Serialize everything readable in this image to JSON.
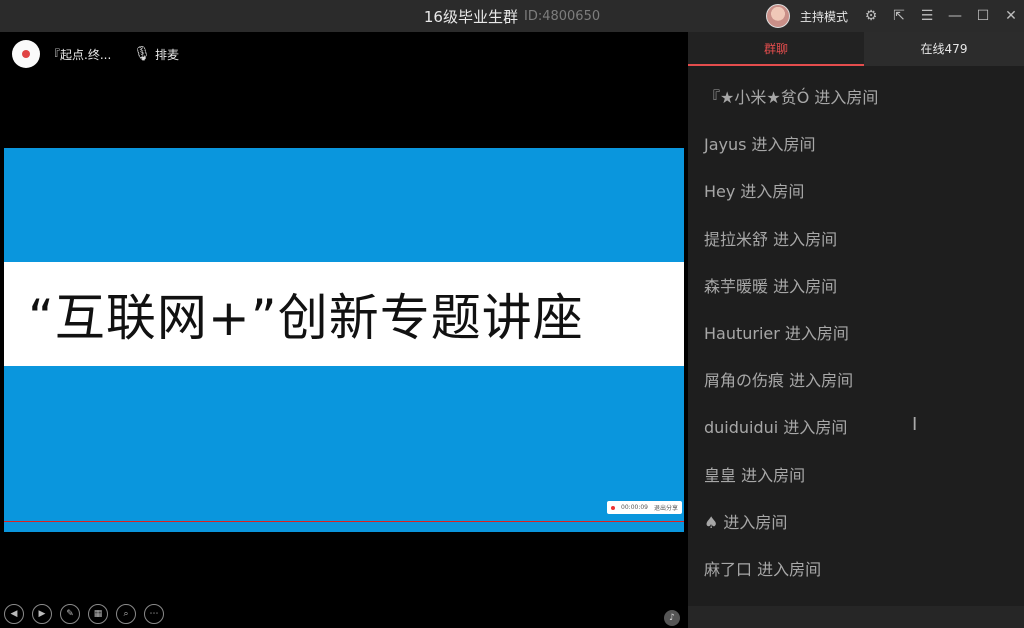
{
  "titlebar": {
    "title": "16级毕业生群",
    "room_id": "ID:4800650",
    "host_mode_label": "主持模式",
    "icons": [
      "host-avatar",
      "gear-icon",
      "popout-icon",
      "menu-icon",
      "minimize-icon",
      "maximize-icon",
      "close-icon"
    ]
  },
  "stage": {
    "presenter_name": "『起点.终...",
    "queue_label": "排麦",
    "slide": {
      "title": "“互联网+”创新专题讲座",
      "colors": {
        "background": "#0a96dd",
        "band": "#ffffff"
      },
      "recording": {
        "time": "00:00:09",
        "exit_label": "退出分享"
      }
    },
    "controls": [
      "prev-icon",
      "next-icon",
      "pen-icon",
      "layout-icon",
      "zoom-icon",
      "more-icon"
    ]
  },
  "panel": {
    "tabs": [
      {
        "label": "群聊",
        "active": true
      },
      {
        "label": "在线479",
        "active": false
      }
    ],
    "messages": [
      "『★小米★贫Ó 进入房间",
      "Jayus 进入房间",
      "Hey 进入房间",
      "提拉米舒 进入房间",
      "森芋暖暖 进入房间",
      "Hauturier 进入房间",
      "屑角の伤痕 进入房间",
      "duiduidui 进入房间",
      "皇皇 进入房间",
      "♠ 进入房间",
      "麻了口 进入房间"
    ]
  },
  "colors": {
    "accent": "#e44d4d",
    "panel_bg": "#1e1e1e",
    "titlebar_bg": "#2b2b2b"
  }
}
